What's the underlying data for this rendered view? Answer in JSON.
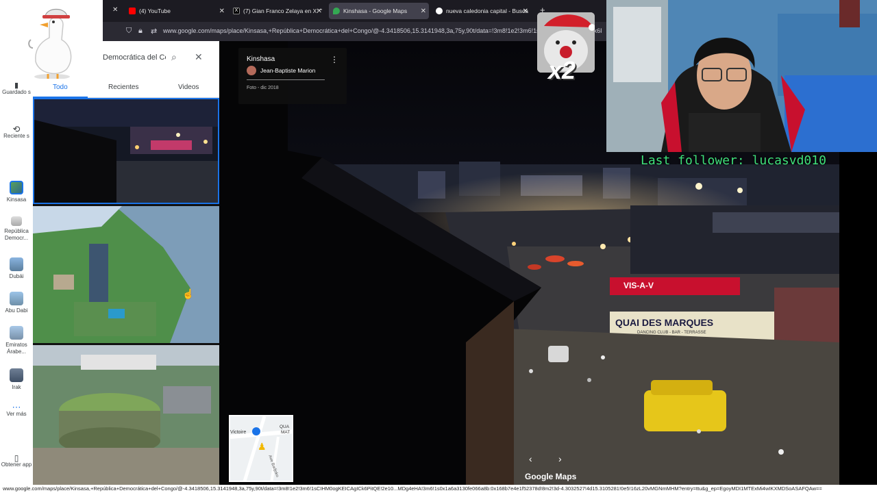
{
  "browser": {
    "tabs": [
      {
        "label": "(4) YouTube",
        "active": false
      },
      {
        "label": "(7) Gian Franco Zelaya en X: \"",
        "active": false
      },
      {
        "label": "Kinshasa - Google Maps",
        "active": true
      },
      {
        "label": "nueva caledonia capital - Busca",
        "active": false
      }
    ],
    "url": "www.google.com/maps/place/Kinsasa,+República+Democrática+del+Congo/@-4.3418506,15.3141948,3a,75y,90t/data=!3m8!1e2!3m6!1sCIHM0ogKEICAgICk6PitQE!2e10"
  },
  "sidebar": {
    "search_query": "Democrática del Co",
    "rail": [
      {
        "label": "Guardado s",
        "icon": "bookmark-icon"
      },
      {
        "label": "Reciente s",
        "icon": "history-icon"
      },
      {
        "label": "Kinsasa",
        "icon": "place-thumb"
      },
      {
        "label": "República Democr...",
        "icon": "place-thumb"
      },
      {
        "label": "Dubái",
        "icon": "place-thumb"
      },
      {
        "label": "Abu Dabi",
        "icon": "place-thumb"
      },
      {
        "label": "Emiratos Árabe...",
        "icon": "place-thumb"
      },
      {
        "label": "Irak",
        "icon": "place-thumb"
      },
      {
        "label": "Ver más",
        "icon": "more-icon"
      },
      {
        "label": "Obtener app",
        "icon": "phone-icon"
      }
    ],
    "tabs": [
      {
        "label": "Todo",
        "active": true
      },
      {
        "label": "Recientes",
        "active": false
      },
      {
        "label": "Videos",
        "active": false
      }
    ]
  },
  "photo_card": {
    "title": "Kinshasa",
    "author": "Jean-Baptiste Marion",
    "date": "Foto - dic 2018"
  },
  "minimap": {
    "label_victoire": "Victoire",
    "label_qua": "QUA",
    "label_mat": "MAT",
    "label_ave": "Ave Badjoko"
  },
  "street_view": {
    "brand": "Google Maps",
    "signs": {
      "vis": "VIS-A-V",
      "quai": "QUAI DES MARQUES",
      "quai_sub": "DANCING CLUB - BAR - TERRASSE"
    }
  },
  "overlay": {
    "multiplier": "x2",
    "last_follower": "Last follower: lucasvd010"
  },
  "status_url": "www.google.com/maps/place/Kinsasa,+República+Democrática+del+Congo/@-4.3418506,15.3141948,3a,75y,90t/data=!3m8!1e2!3m6!1sCIHM0ogKEICAgICk6PitQE!2e10...MDg4eHA!3m6!1s0x1a6a3130fe066a8b:0x168b7e4e1f52378d!8m2!3d-4.3032527!4d15.3105281!0e5!16zL20vMGNmMHM?entry=ttu&g_ep=EgoyMDI1MTExMi4wIKXMDSoASAFQAw==",
  "colors": {
    "accent_blue": "#1a73e8",
    "follower_green": "#3fe07a",
    "quai_sign": "#e8e2c8",
    "vis_sign": "#c8102e",
    "taxi_yellow": "#e6c61a"
  }
}
